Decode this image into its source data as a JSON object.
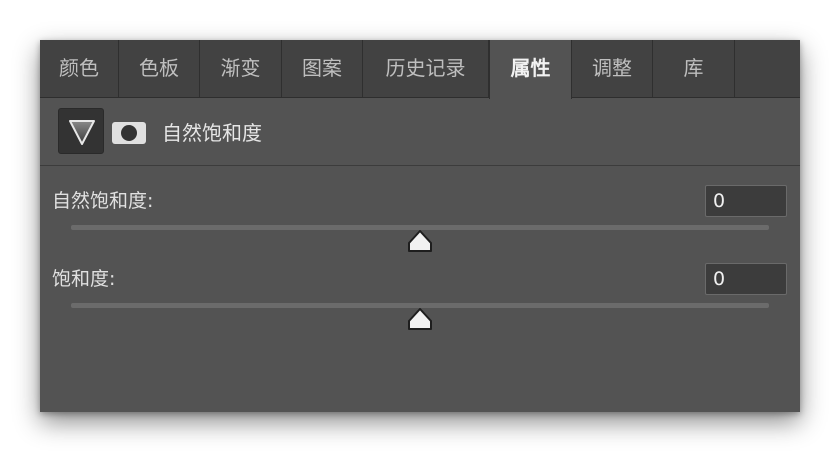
{
  "tabs": [
    {
      "label": "颜色",
      "active": false
    },
    {
      "label": "色板",
      "active": false
    },
    {
      "label": "渐变",
      "active": false
    },
    {
      "label": "图案",
      "active": false
    },
    {
      "label": "历史记录",
      "active": false
    },
    {
      "label": "属性",
      "active": true
    },
    {
      "label": "调整",
      "active": false
    },
    {
      "label": "库",
      "active": false
    }
  ],
  "header": {
    "adjustment_icon": "vibrance-triangle-icon",
    "mask_icon": "layer-mask-icon",
    "title": "自然饱和度"
  },
  "controls": {
    "vibrance": {
      "label": "自然饱和度:",
      "value": "0",
      "min": -100,
      "max": 100
    },
    "saturation": {
      "label": "饱和度:",
      "value": "0",
      "min": -100,
      "max": 100
    }
  },
  "colors": {
    "panel_bg": "#535353",
    "tabbar_bg": "#424242",
    "track": "#6b6b6b",
    "thumb": "#f2f2f2"
  }
}
